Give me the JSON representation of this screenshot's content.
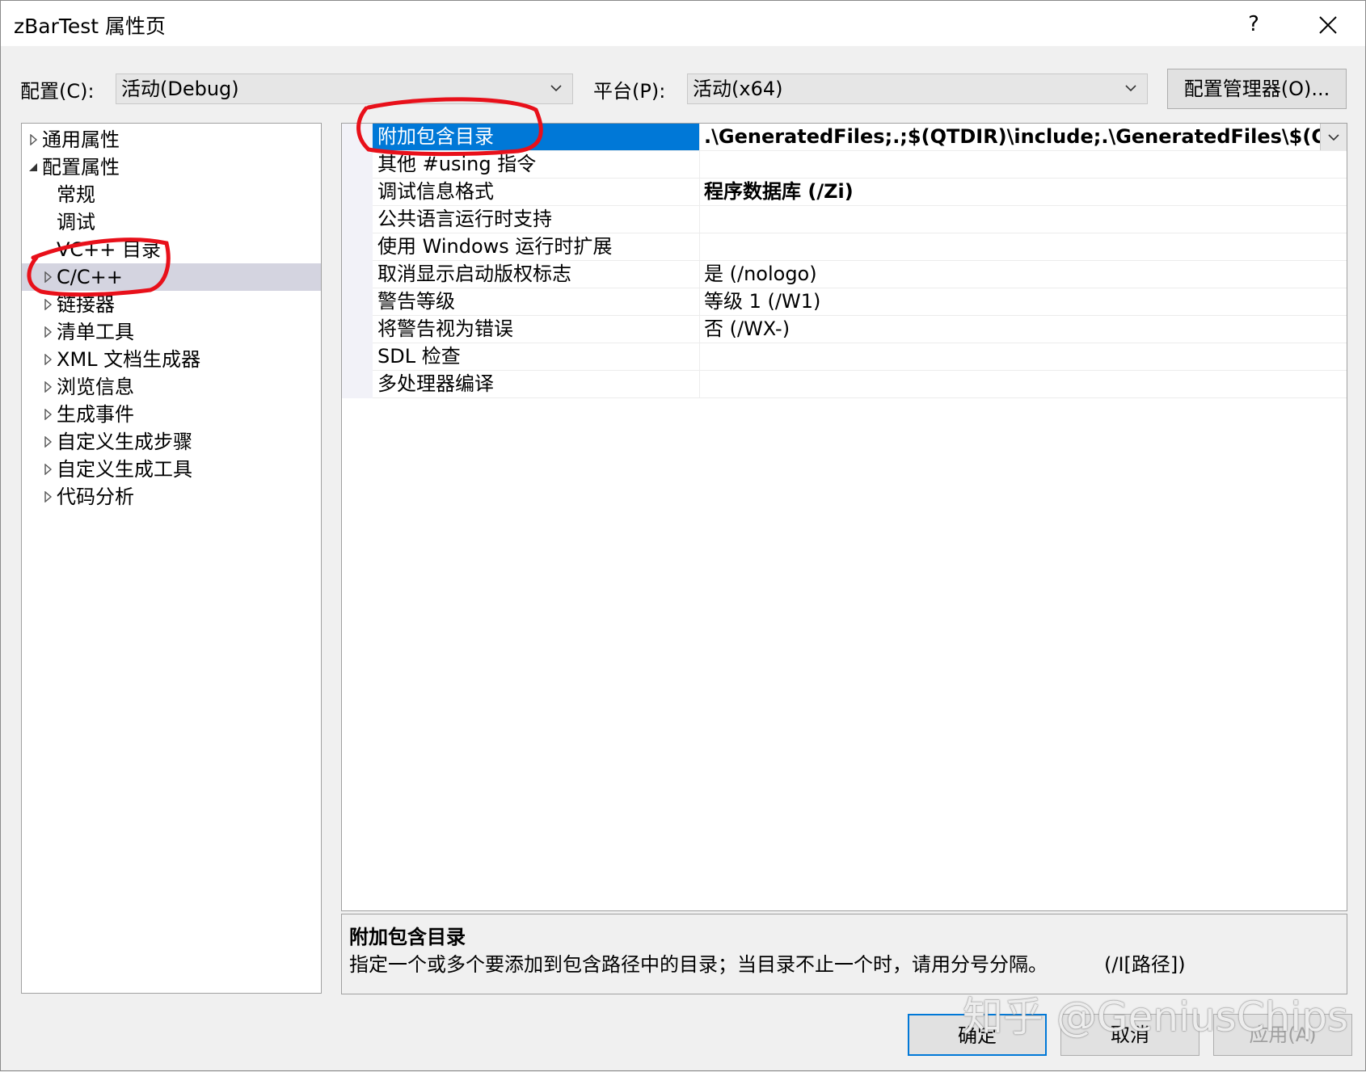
{
  "window": {
    "title": "zBarTest 属性页",
    "help_label": "?"
  },
  "config": {
    "label": "配置(C):",
    "value": "活动(Debug)",
    "platform_label": "平台(P):",
    "platform_value": "活动(x64)",
    "manager_button": "配置管理器(O)..."
  },
  "tree": {
    "items": [
      {
        "label": "通用属性",
        "expander": "collapsed"
      },
      {
        "label": "配置属性",
        "expander": "expanded"
      },
      {
        "label": "常规",
        "expander": "none"
      },
      {
        "label": "调试",
        "expander": "none"
      },
      {
        "label": "VC++ 目录",
        "expander": "none"
      },
      {
        "label": "C/C++",
        "expander": "collapsed",
        "selected": true
      },
      {
        "label": "链接器",
        "expander": "collapsed"
      },
      {
        "label": "清单工具",
        "expander": "collapsed"
      },
      {
        "label": "XML 文档生成器",
        "expander": "collapsed"
      },
      {
        "label": "浏览信息",
        "expander": "collapsed"
      },
      {
        "label": "生成事件",
        "expander": "collapsed"
      },
      {
        "label": "自定义生成步骤",
        "expander": "collapsed"
      },
      {
        "label": "自定义生成工具",
        "expander": "collapsed"
      },
      {
        "label": "代码分析",
        "expander": "collapsed"
      }
    ]
  },
  "properties": [
    {
      "name": "附加包含目录",
      "value": ".\\GeneratedFiles;.;$(QTDIR)\\include;.\\GeneratedFiles\\$(ConfigurationName)",
      "selected": true,
      "bold": true
    },
    {
      "name": "其他 #using 指令",
      "value": ""
    },
    {
      "name": "调试信息格式",
      "value": "程序数据库 (/Zi)",
      "bold": true
    },
    {
      "name": "公共语言运行时支持",
      "value": ""
    },
    {
      "name": "使用 Windows 运行时扩展",
      "value": ""
    },
    {
      "name": "取消显示启动版权标志",
      "value": "是 (/nologo)"
    },
    {
      "name": "警告等级",
      "value": "等级 1 (/W1)"
    },
    {
      "name": "将警告视为错误",
      "value": "否 (/WX-)"
    },
    {
      "name": "SDL 检查",
      "value": ""
    },
    {
      "name": "多处理器编译",
      "value": ""
    }
  ],
  "description": {
    "title": "附加包含目录",
    "text": "指定一个或多个要添加到包含路径中的目录；当目录不止一个时，请用分号分隔。",
    "switch": "(/I[路径])"
  },
  "buttons": {
    "ok": "确定",
    "cancel": "取消",
    "apply": "应用(A)"
  },
  "watermark": "知乎 @GeniusChips",
  "colors": {
    "selection_blue": "#0078d7",
    "tree_selection": "#d4d4e0",
    "annotation_red": "#e8101a"
  }
}
